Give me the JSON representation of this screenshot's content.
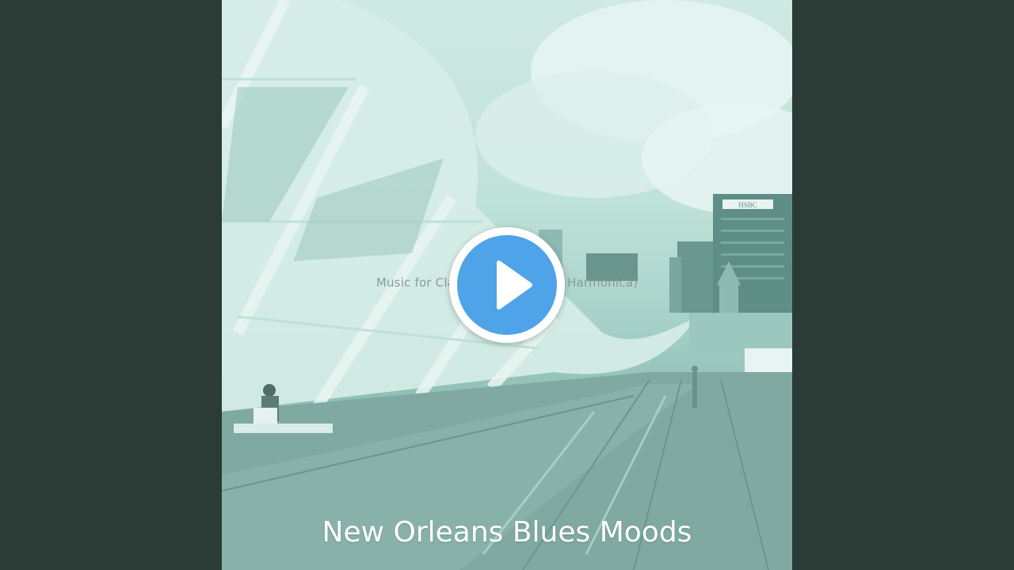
{
  "video": {
    "subtitle": "Music for Classy Nights - Blues Harmonica)",
    "artist": "New Orleans Blues Moods",
    "building_sign": "HSBC"
  },
  "player": {
    "play_icon": "play-icon",
    "accent_color": "#4fa3e8"
  },
  "colors": {
    "background": "#2b3b36",
    "tint": "#a9d3ca"
  }
}
